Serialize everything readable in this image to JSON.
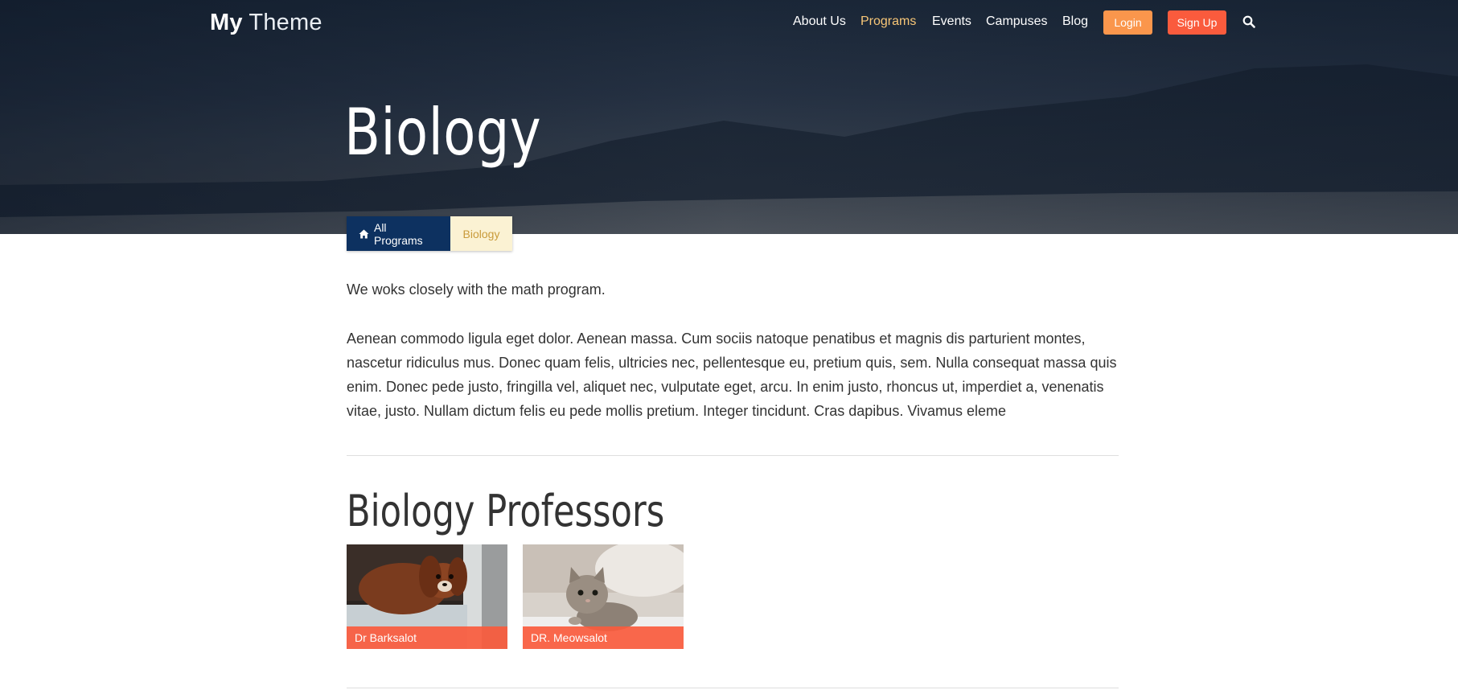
{
  "header": {
    "logo_bold": "My",
    "logo_light": "Theme",
    "nav": [
      {
        "label": "About Us",
        "active": false
      },
      {
        "label": "Programs",
        "active": true
      },
      {
        "label": "Events",
        "active": false
      },
      {
        "label": "Campuses",
        "active": false
      },
      {
        "label": "Blog",
        "active": false
      }
    ],
    "login_label": "Login",
    "signup_label": "Sign Up",
    "search_icon": "search-icon"
  },
  "hero": {
    "title": "Biology"
  },
  "breadcrumb": {
    "home_icon": "home-icon",
    "all_label": "All Programs",
    "current_label": "Biology"
  },
  "content": {
    "intro": "We woks closely with the math program.",
    "body": "Aenean commodo ligula eget dolor. Aenean massa. Cum sociis natoque penatibus et magnis dis parturient montes, nascetur ridiculus mus. Donec quam felis, ultricies nec, pellentesque eu, pretium quis, sem. Nulla consequat massa quis enim. Donec pede justo, fringilla vel, aliquet nec, vulputate eget, arcu. In enim justo, rhoncus ut, imperdiet a, venenatis vitae, justo. Nullam dictum felis eu pede mollis pretium. Integer tincidunt. Cras dapibus. Vivamus eleme"
  },
  "professors": {
    "title": "Biology Professors",
    "items": [
      {
        "name": "Dr Barksalot"
      },
      {
        "name": "DR. Meowsalot"
      }
    ]
  },
  "colors": {
    "accent_orange": "#fa964c",
    "accent_red": "#fa5b3d",
    "navy": "#0d3160",
    "active_nav": "#f7c677"
  }
}
